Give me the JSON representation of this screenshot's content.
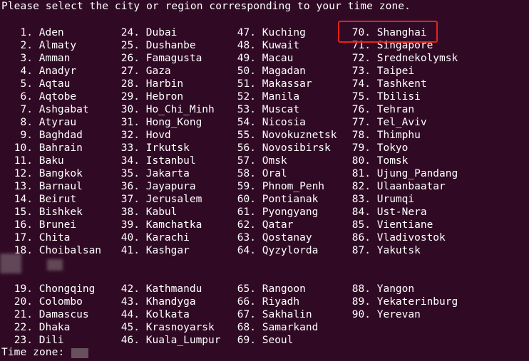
{
  "terminal": {
    "prompt": "Please select the city or region corresponding to your time zone.",
    "input_label": "Time zone:",
    "input_value": "",
    "highlighted_choice": "70. Shanghai",
    "columns": [
      [
        "1. Aden",
        "2. Almaty",
        "3. Amman",
        "4. Anadyr",
        "5. Aqtau",
        "6. Aqtobe",
        "7. Ashgabat",
        "8. Atyrau",
        "9. Baghdad",
        "10. Bahrain",
        "11. Baku",
        "12. Bangkok",
        "13. Barnaul",
        "14. Beirut",
        "15. Bishkek",
        "16. Brunei",
        "17. Chita",
        "18. Choibalsan",
        "",
        "",
        "19. Chongqing",
        "20. Colombo",
        "21. Damascus",
        "22. Dhaka",
        "23. Dili"
      ],
      [
        "24. Dubai",
        "25. Dushanbe",
        "26. Famagusta",
        "27. Gaza",
        "28. Harbin",
        "29. Hebron",
        "30. Ho_Chi_Minh",
        "31. Hong_Kong",
        "32. Hovd",
        "33. Irkutsk",
        "34. Istanbul",
        "35. Jakarta",
        "36. Jayapura",
        "37. Jerusalem",
        "38. Kabul",
        "39. Kamchatka",
        "40. Karachi",
        "41. Kashgar",
        "",
        "",
        "42. Kathmandu",
        "43. Khandyga",
        "44. Kolkata",
        "45. Krasnoyarsk",
        "46. Kuala_Lumpur"
      ],
      [
        "47. Kuching",
        "48. Kuwait",
        "49. Macau",
        "50. Magadan",
        "51. Makassar",
        "52. Manila",
        "53. Muscat",
        "54. Nicosia",
        "55. Novokuznetsk",
        "56. Novosibirsk",
        "57. Omsk",
        "58. Oral",
        "59. Phnom_Penh",
        "60. Pontianak",
        "61. Pyongyang",
        "62. Qatar",
        "63. Qostanay",
        "64. Qyzylorda",
        "",
        "",
        "65. Rangoon",
        "66. Riyadh",
        "67. Sakhalin",
        "68. Samarkand",
        "69. Seoul"
      ],
      [
        "70. Shanghai",
        "71. Singapore",
        "72. Srednekolymsk",
        "73. Taipei",
        "74. Tashkent",
        "75. Tbilisi",
        "76. Tehran",
        "77. Tel_Aviv",
        "78. Thimphu",
        "79. Tokyo",
        "80. Tomsk",
        "81. Ujung_Pandang",
        "82. Ulaanbaatar",
        "83. Urumqi",
        "84. Ust-Nera",
        "85. Vientiane",
        "86. Vladivostok",
        "87. Yakutsk",
        "",
        "",
        "88. Yangon",
        "89. Yekaterinburg",
        "90. Yerevan",
        "",
        ""
      ]
    ]
  },
  "colors": {
    "background": "#300a24",
    "text": "#ffffff",
    "highlight_border": "#e2231a"
  }
}
